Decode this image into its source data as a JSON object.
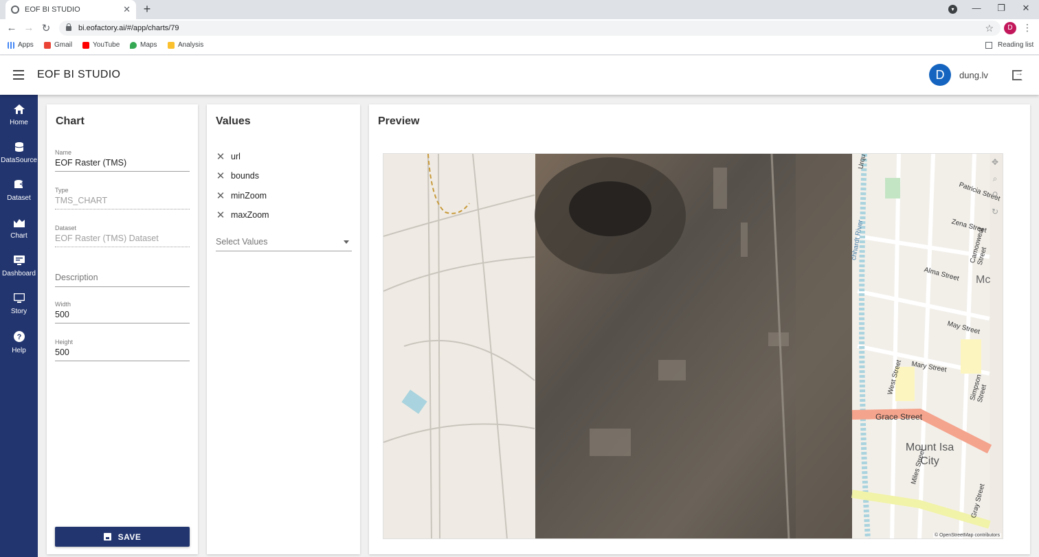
{
  "browser": {
    "tab_title": "EOF BI STUDIO",
    "tab_close": "✕",
    "new_tab": "+",
    "url": "bi.eofactory.ai/#/app/charts/79",
    "profile_initial": "D",
    "bookmarks": [
      "Apps",
      "Gmail",
      "YouTube",
      "Maps",
      "Analysis"
    ],
    "reading_list": "Reading list"
  },
  "app": {
    "title": "EOF BI STUDIO",
    "user_initial": "D",
    "user_name": "dung.lv"
  },
  "sidebar": {
    "items": [
      {
        "label": "Home",
        "icon": "home-icon"
      },
      {
        "label": "DataSource",
        "icon": "database-icon"
      },
      {
        "label": "Dataset",
        "icon": "dataset-icon"
      },
      {
        "label": "Chart",
        "icon": "chart-icon"
      },
      {
        "label": "Dashboard",
        "icon": "dashboard-icon"
      },
      {
        "label": "Story",
        "icon": "story-icon"
      },
      {
        "label": "Help",
        "icon": "help-icon"
      }
    ]
  },
  "chart_panel": {
    "title": "Chart",
    "name_label": "Name",
    "name_value": "EOF Raster (TMS)",
    "type_label": "Type",
    "type_value": "TMS_CHART",
    "dataset_label": "Dataset",
    "dataset_value": "EOF Raster (TMS) Dataset",
    "description_placeholder": "Description",
    "width_label": "Width",
    "width_value": "500",
    "height_label": "Height",
    "height_value": "500",
    "save_label": "SAVE"
  },
  "values_panel": {
    "title": "Values",
    "items": [
      "url",
      "bounds",
      "minZoom",
      "maxZoom"
    ],
    "select_placeholder": "Select Values"
  },
  "preview_panel": {
    "title": "Preview",
    "map_labels": [
      "Grace Street",
      "Mount Isa City",
      "Zena Street",
      "Alma Street",
      "May Street",
      "Mary Street",
      "West Street",
      "Miles Street",
      "Patricia Street",
      "Simpson Street",
      "Camooweal Street",
      "Gray Street",
      "Urqu",
      "Mc",
      "chhardt River"
    ],
    "attribution": "© OpenStreetMap contributors"
  }
}
